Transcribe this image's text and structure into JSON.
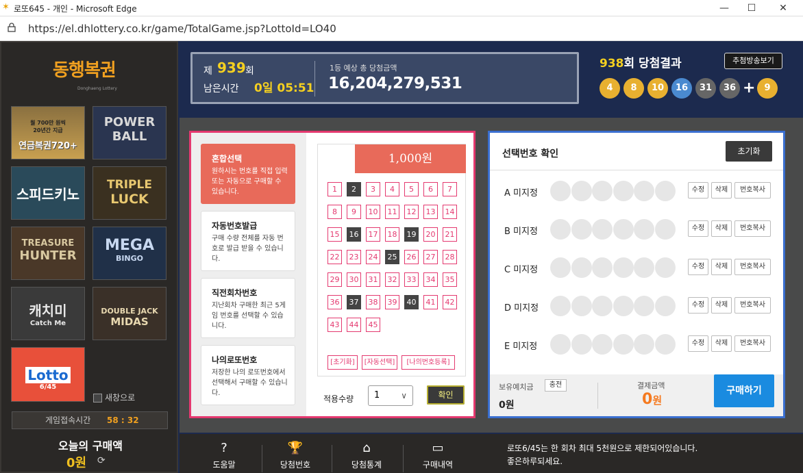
{
  "window": {
    "title": "로또645 - 개인 - Microsoft Edge",
    "minimize": "—",
    "maximize": "☐",
    "close": "✕"
  },
  "address": {
    "url": "https://el.dhlottery.co.kr/game/TotalGame.jsp?LottoId=LO40"
  },
  "sidebar": {
    "brand": "동행복권",
    "brand_sub": "Donghaeng Lottery",
    "games": [
      {
        "line1": "월 700만 원씩",
        "line2": "20년간 지급",
        "line3": "연금복권720+"
      },
      {
        "line1": "POWER",
        "line2": "BALL"
      },
      {
        "line1": "스피드키노"
      },
      {
        "line1": "TRIPLE",
        "line2": "LUCK"
      },
      {
        "line1": "TREASURE",
        "line2": "HUNTER"
      },
      {
        "line1": "MEGA",
        "line2": "BINGO"
      },
      {
        "line1": "캐치미",
        "line2": "Catch Me"
      },
      {
        "line1": "DOUBLE JACK",
        "line2": "MIDAS"
      },
      {
        "line1": "Lotto",
        "line2": "6/45"
      }
    ],
    "new_window": "새창으로",
    "timer_label": "게임접속시간",
    "timer_value": "58 : 32",
    "today_label": "오늘의 구매액",
    "today_value": "0원"
  },
  "round": {
    "je": "제",
    "number": "939",
    "hoe": "회",
    "remain_label": "남은시간",
    "remain_value": "0일 05:51",
    "jackpot_label": "1등 예상 총 당첨금액",
    "jackpot_value": "16,204,279,531"
  },
  "result": {
    "round": "938",
    "title": "회 당첨결과",
    "draw_button": "추첨방송보기",
    "balls": [
      "4",
      "8",
      "10",
      "16",
      "31",
      "36"
    ],
    "plus": "+",
    "bonus": "9"
  },
  "pick": {
    "options": [
      {
        "title": "혼합선택",
        "desc": "원하시는 번호를 직접 입력 또는 자동으로 구매할 수 있습니다."
      },
      {
        "title": "자동번호발급",
        "desc": "구매 수량 전체를 자동 번호로 발급 받을 수 있습니다."
      },
      {
        "title": "직전회차번호",
        "desc": "지난회차 구매한 최근 5게임 번호를 선택할 수 있습니다."
      },
      {
        "title": "나의로또번호",
        "desc": "저장한 나의 로또번호에서 선택해서 구매할 수 있습니다."
      }
    ],
    "price": "1,000원",
    "numbers": [
      "1",
      "2",
      "3",
      "4",
      "5",
      "6",
      "7",
      "8",
      "9",
      "10",
      "11",
      "12",
      "13",
      "14",
      "15",
      "16",
      "17",
      "18",
      "19",
      "20",
      "21",
      "22",
      "23",
      "24",
      "25",
      "26",
      "27",
      "28",
      "29",
      "30",
      "31",
      "32",
      "33",
      "34",
      "35",
      "36",
      "37",
      "38",
      "39",
      "40",
      "41",
      "42",
      "43",
      "44",
      "45"
    ],
    "selected": [
      "2",
      "16",
      "19",
      "25",
      "37",
      "40"
    ],
    "btn_reset": "[초기화]",
    "btn_auto": "[자동선택]",
    "btn_mine": "[나의번호등록]",
    "qty_label": "적용수량",
    "qty_value": "1",
    "qty_chevron": "∨",
    "ok": "확인"
  },
  "confirm": {
    "title": "선택번호 확인",
    "reset": "초기화",
    "rows": [
      {
        "label": "A 미지정"
      },
      {
        "label": "B 미지정"
      },
      {
        "label": "C 미지정"
      },
      {
        "label": "D 미지정"
      },
      {
        "label": "E 미지정"
      }
    ],
    "edit": "수정",
    "delete": "삭제",
    "copy": "번호복사",
    "balance_label": "보유예치금",
    "charge": "충전",
    "balance_value": "0원",
    "pay_label": "결제금액",
    "pay_value": "0",
    "pay_unit": "원",
    "buy": "구매하기"
  },
  "bottom": {
    "nav": [
      {
        "label": "도움말",
        "icon": "?"
      },
      {
        "label": "당첨번호",
        "icon": "🏆"
      },
      {
        "label": "당첨통계",
        "icon": "⌂"
      },
      {
        "label": "구매내역",
        "icon": "▭"
      }
    ],
    "notice1": "로또6/45는 한 회차 최대 5천원으로 제한되어있습니다.",
    "notice2": "좋은하루되세요."
  }
}
